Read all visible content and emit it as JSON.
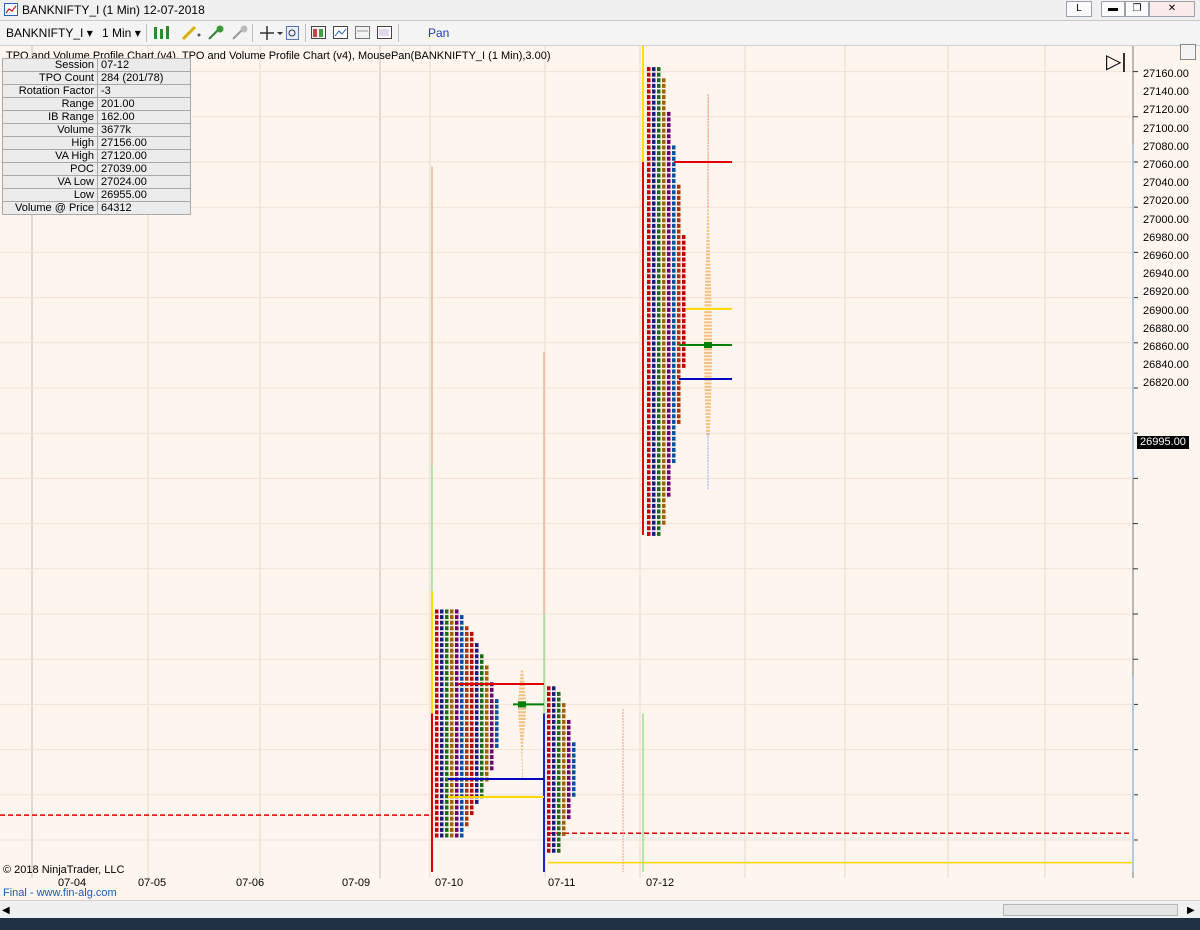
{
  "window": {
    "title": "BANKNIFTY_I (1 Min)  12-07-2018",
    "link_button": "L",
    "minimize_glyph": "▬",
    "restore_glyph": "❐",
    "close_glyph": "✕"
  },
  "toolbar": {
    "instrument": "BANKNIFTY_I",
    "interval": "1 Min",
    "mode": "Pan",
    "dropdown_glyph": "▾",
    "icons": [
      "bar-type-icon",
      "drawing-tool-icon",
      "pin-icon",
      "pin-gray-icon",
      "crosshair-icon",
      "properties-icon",
      "strategy-icon",
      "chart-trader-icon",
      "template-icon",
      "data-box-icon"
    ]
  },
  "indicator_title": "TPO and Volume Profile Chart (v4),  TPO and Volume Profile Chart (v4), MousePan(BANKNIFTY_I (1 Min),3.00)",
  "info_table": [
    {
      "label": "Session",
      "value": "07-12"
    },
    {
      "label": "TPO Count",
      "value": "284 (201/78)"
    },
    {
      "label": "Rotation Factor",
      "value": "-3"
    },
    {
      "label": "Range",
      "value": "201.00"
    },
    {
      "label": "IB Range",
      "value": "162.00"
    },
    {
      "label": "Volume",
      "value": "3677k"
    },
    {
      "label": "High",
      "value": "27156.00"
    },
    {
      "label": "VA High",
      "value": "27120.00"
    },
    {
      "label": "POC",
      "value": "27039.00"
    },
    {
      "label": "VA Low",
      "value": "27024.00"
    },
    {
      "label": "Low",
      "value": "26955.00"
    },
    {
      "label": "Volume @ Price",
      "value": "64312"
    }
  ],
  "price_axis": [
    "27160.00",
    "27140.00",
    "27120.00",
    "27100.00",
    "27080.00",
    "27060.00",
    "27040.00",
    "27020.00",
    "27000.00",
    "26980.00",
    "26960.00",
    "26940.00",
    "26920.00",
    "26900.00",
    "26880.00",
    "26860.00",
    "26840.00",
    "26820.00"
  ],
  "current_price": "26995.00",
  "date_axis": [
    "07-04",
    "07-05",
    "07-06",
    "07-09",
    "07-10",
    "07-11",
    "07-12"
  ],
  "copyright": "© 2018 NinjaTrader, LLC",
  "footer": "Final - www.fin-alg.com",
  "nav_glyph": "▷|",
  "colors": {
    "vah": "#e00000",
    "poc": "#008000",
    "val": "#0000c0",
    "ib": "#ffe000"
  }
}
